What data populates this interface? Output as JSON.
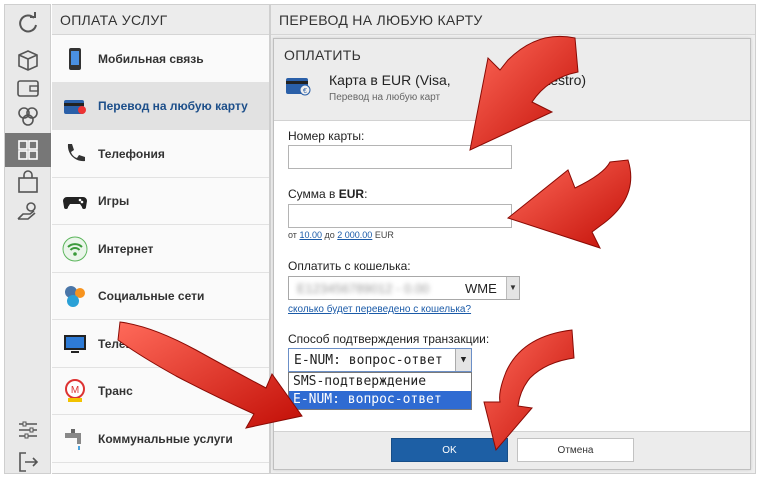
{
  "left_rail": {
    "icons": [
      "refresh-icon",
      "box-icon",
      "wallet-icon",
      "coins-icon",
      "services-icon",
      "gift-bag-icon",
      "hand-coin-icon",
      "sliders-icon",
      "logout-icon"
    ]
  },
  "services": {
    "title": "ОПЛАТА УСЛУГ",
    "items": [
      {
        "label": "Мобильная связь",
        "icon": "mobile-phone-icon"
      },
      {
        "label": "Перевод на любую карту",
        "icon": "bank-card-icon"
      },
      {
        "label": "Телефония",
        "icon": "telephone-icon"
      },
      {
        "label": "Игры",
        "icon": "gamepad-icon"
      },
      {
        "label": "Интернет",
        "icon": "wifi-icon"
      },
      {
        "label": "Социальные сети",
        "icon": "social-icon"
      },
      {
        "label": "Телевидение",
        "icon": "tv-icon"
      },
      {
        "label": "Транс",
        "icon": "transport-icon"
      },
      {
        "label": "Коммунальные услуги",
        "icon": "faucet-icon"
      }
    ]
  },
  "transfer": {
    "title": "ПЕРЕВОД НА ЛЮБУЮ КАРТУ",
    "dialog": {
      "title": "ОПЛАТИТЬ",
      "card_name": "Карта в EUR (Visa,",
      "card_name_tail": "Card, Maestro)",
      "card_subtitle": "Перевод на любую карт",
      "card_number_label": "Номер карты:",
      "card_number_value": "",
      "amount_label_prefix": "Сумма в ",
      "amount_label_currency": "EUR",
      "amount_label_suffix": ":",
      "amount_value": "",
      "range_from_word": "от",
      "range_min": "10.00",
      "range_to_word": "до",
      "range_max": "2 000.00",
      "range_currency": "EUR",
      "wallet_label": "Оплатить с кошелька:",
      "wallet_value_hidden": "E123456789012 - 0.00",
      "wallet_type": "WME",
      "wallet_link": "сколько будет переведено с кошелька?",
      "confirm_label": "Способ подтверждения транзакции:",
      "confirm_selected": "E-NUM: вопрос-ответ",
      "confirm_options": [
        "SMS-подтверждение",
        "E-NUM: вопрос-ответ"
      ],
      "ok_label": "OK",
      "cancel_label": "Отмена"
    }
  },
  "colors": {
    "accent_blue": "#1d5fa5",
    "highlight_option": "#2f6bd2",
    "arrow_red": "#e01a10"
  }
}
